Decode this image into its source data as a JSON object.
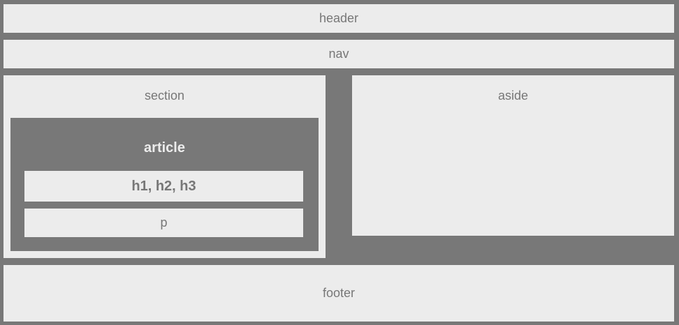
{
  "colors": {
    "background": "#787878",
    "box": "#ececec",
    "text": "#777777",
    "article_text": "#ececec"
  },
  "layout": {
    "header": "header",
    "nav": "nav",
    "section": {
      "label": "section",
      "article": {
        "label": "article",
        "headings": "h1, h2, h3",
        "paragraph": "p"
      }
    },
    "aside": "aside",
    "footer": "footer"
  }
}
